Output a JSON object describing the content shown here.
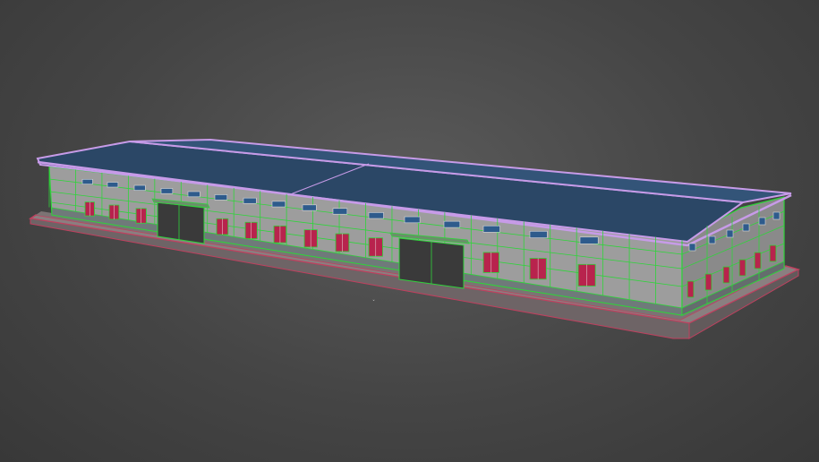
{
  "viewport": {
    "background_top": "#5a5a5a",
    "background_bottom": "#383838"
  },
  "model": {
    "roof_color": "#2b4766",
    "roof_edge_color": "#c79be8",
    "wall_color": "#9d9d9d",
    "wall_dark_color": "#7e7e7e",
    "wireframe_color": "#2fd43a",
    "window_color": "#2e5b8c",
    "door_color": "#b8234d",
    "slab_color": "#8a7f80",
    "slab_edge_color": "#c0405f",
    "garage_door_color": "#3a3a3a"
  }
}
